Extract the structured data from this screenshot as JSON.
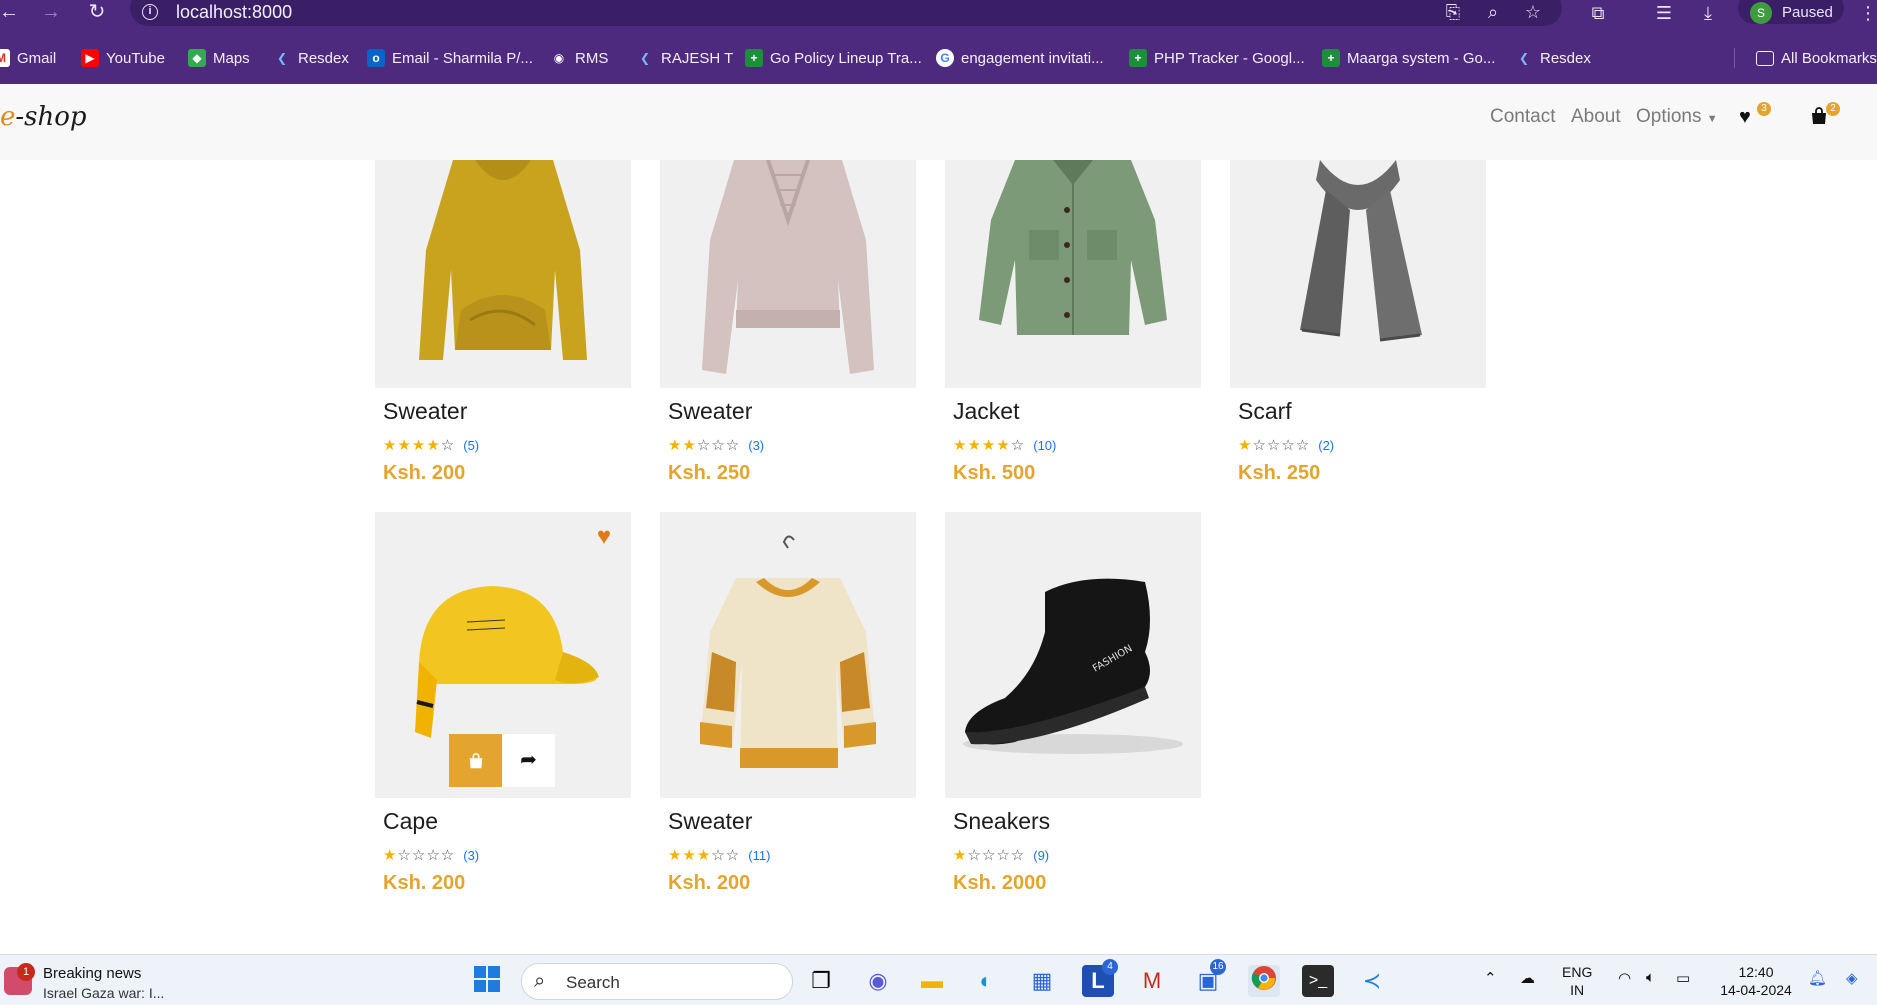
{
  "browser": {
    "url": "localhost:8000",
    "profile_initial": "S",
    "profile_status": "Paused",
    "bookmarks": [
      {
        "label": "Gmail"
      },
      {
        "label": "YouTube"
      },
      {
        "label": "Maps"
      },
      {
        "label": "Resdex"
      },
      {
        "label": "Email - Sharmila P/..."
      },
      {
        "label": "RMS"
      },
      {
        "label": "RAJESH T"
      },
      {
        "label": "Go Policy Lineup Tra..."
      },
      {
        "label": "engagement invitati..."
      },
      {
        "label": "PHP Tracker - Googl..."
      },
      {
        "label": "Maarga system - Go..."
      },
      {
        "label": "Resdex"
      },
      {
        "label": "All Bookmarks"
      }
    ]
  },
  "site": {
    "logo_prefix": "e",
    "logo_rest": "-shop",
    "menu": {
      "contact": "Contact",
      "about": "About",
      "options": "Options"
    },
    "wishlist_count": "3",
    "cart_count": "2"
  },
  "products": [
    {
      "name": "Sweater",
      "rating": 4.5,
      "stars_full": "★★★★",
      "stars_empty": "☆",
      "reviews": "(5)",
      "price": "Ksh. 200"
    },
    {
      "name": "Sweater",
      "rating": 2,
      "stars_full": "★★",
      "stars_empty": "☆☆☆",
      "reviews": "(3)",
      "price": "Ksh. 250"
    },
    {
      "name": "Jacket",
      "rating": 4,
      "stars_full": "★★★★",
      "stars_empty": "☆",
      "reviews": "(10)",
      "price": "Ksh. 500"
    },
    {
      "name": "Scarf",
      "rating": 1,
      "stars_full": "★",
      "stars_empty": "☆☆☆☆",
      "reviews": "(2)",
      "price": "Ksh. 250"
    },
    {
      "name": "Cape",
      "rating": 1.5,
      "stars_full": "★",
      "stars_empty": "☆☆☆☆",
      "reviews": "(3)",
      "price": "Ksh. 200"
    },
    {
      "name": "Sweater",
      "rating": 3,
      "stars_full": "★★★",
      "stars_empty": "☆☆",
      "reviews": "(11)",
      "price": "Ksh. 200"
    },
    {
      "name": "Sneakers",
      "rating": 1.5,
      "stars_full": "★",
      "stars_empty": "☆☆☆☆",
      "reviews": "(9)",
      "price": "Ksh. 2000"
    }
  ],
  "taskbar": {
    "news_badge": "1",
    "news_title": "Breaking news",
    "news_sub": "Israel Gaza war: I...",
    "search_label": "Search",
    "badge_l": "4",
    "badge_teams": "16",
    "lang_top": "ENG",
    "lang_bottom": "IN",
    "time": "12:40",
    "date": "14-04-2024"
  },
  "colors": {
    "browser_bar": "#4e2a7f",
    "accent": "#e3a530",
    "heart": "#e07b14",
    "star": "#f3b200"
  }
}
